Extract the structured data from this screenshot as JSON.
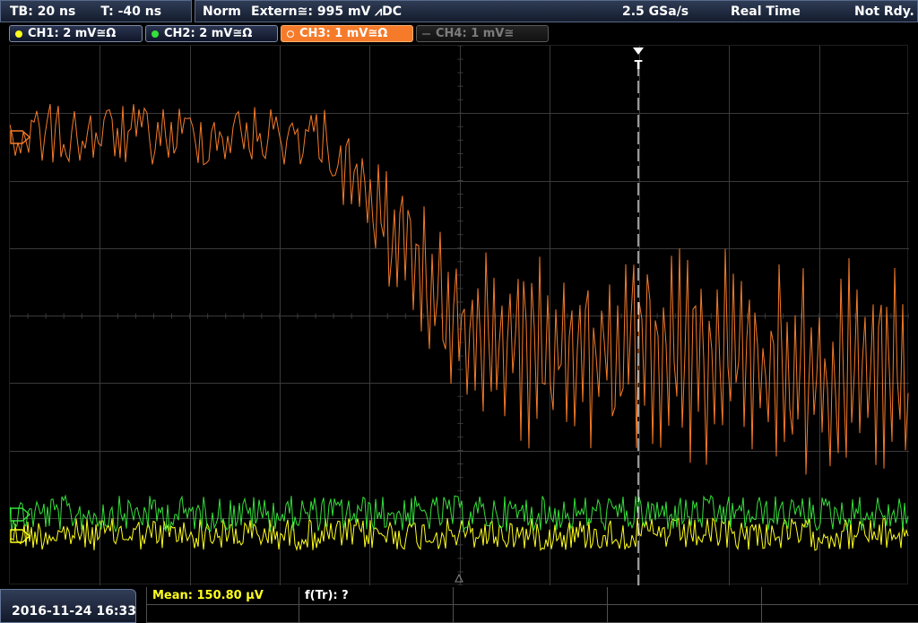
{
  "topbar": {
    "timebase": "TB: 20 ns",
    "trigger_time": "T: -40 ns",
    "mode": "Norm",
    "trigger_source": "Extern≅: 995 mV ⩘DC",
    "sample_rate": "2.5 GSa/s",
    "acq_mode": "Real Time",
    "status": "Not Rdy."
  },
  "channels": [
    {
      "label": "CH1: 2 mV≅Ω",
      "color": "#ffff1e",
      "active": false
    },
    {
      "label": "CH2: 2 mV≅Ω",
      "color": "#35e03a",
      "active": false
    },
    {
      "label": "CH3: 1 mV≅Ω",
      "color": "#f57b2a",
      "active": true
    },
    {
      "label": "CH4: 1 mV≅",
      "color": "#7c7c7c",
      "active": false
    }
  ],
  "markers": {
    "trigger": "T"
  },
  "bottom": {
    "datetime": "2016-11-24 16:33",
    "measurements": [
      {
        "label": "Mean: 150.80 µV"
      },
      {
        "label": "f(Tr): ?"
      }
    ]
  },
  "colors": {
    "ch1": "#ffff1e",
    "ch2": "#35e03a",
    "ch3": "#f57b2a",
    "grid": "#3a3a3a"
  }
}
